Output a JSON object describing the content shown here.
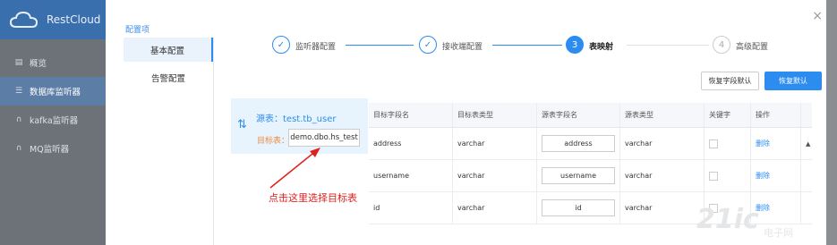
{
  "app": {
    "brand": "RestCloud"
  },
  "sidebar": {
    "items": [
      {
        "icon": "chart-icon",
        "glyph": "▤",
        "label": "概览"
      },
      {
        "icon": "list-icon",
        "glyph": "☰",
        "label": "数据库监听器"
      },
      {
        "icon": "headset-icon",
        "glyph": "∩",
        "label": "kafka监听器"
      },
      {
        "icon": "headset-icon",
        "glyph": "∩",
        "label": "MQ监听器"
      }
    ],
    "active_index": 1
  },
  "modal": {
    "close": "×",
    "config_title": "配置项",
    "config_items": [
      "基本配置",
      "告警配置"
    ],
    "steps": [
      {
        "mark": "✓",
        "label": "监听器配置",
        "state": "done"
      },
      {
        "mark": "✓",
        "label": "接收端配置",
        "state": "done"
      },
      {
        "mark": "3",
        "label": "表映射",
        "state": "current"
      },
      {
        "mark": "4",
        "label": "高级配置",
        "state": "todo"
      }
    ],
    "buttons": {
      "reset_fields": "恢复字段默认",
      "reset_default": "恢复默认"
    },
    "mapping": {
      "icon_glyph": "⇅",
      "source": "源表：test.tb_user",
      "target_label": "目标表：",
      "target_value": "demo.dbo.hs_test"
    },
    "table": {
      "headers": [
        "目标字段名",
        "目标表类型",
        "源表字段名",
        "源表类型",
        "关键字",
        "操作"
      ],
      "rows": [
        {
          "target_field": "address",
          "target_type": "varchar",
          "source_field": "address",
          "source_type": "varchar",
          "action": "删除"
        },
        {
          "target_field": "username",
          "target_type": "varchar",
          "source_field": "username",
          "source_type": "varchar",
          "action": "删除"
        },
        {
          "target_field": "id",
          "target_type": "varchar",
          "source_field": "id",
          "source_type": "varchar",
          "action": "删除"
        }
      ],
      "scroll_up": "▲"
    }
  },
  "annotation": {
    "text": "点击这里选择目标表",
    "color": "#e0211f"
  },
  "watermark": {
    "main": "21ic",
    "sub": "电子网"
  },
  "colors": {
    "primary": "#2d8cf0",
    "header": "#3a6fae",
    "annotation": "#e0211f"
  }
}
